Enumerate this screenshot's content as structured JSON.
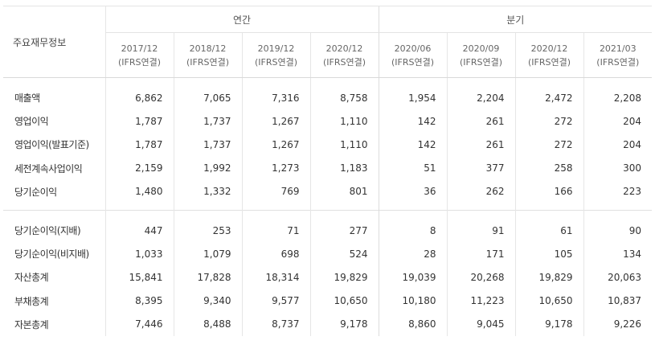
{
  "header": {
    "row_label": "주요재무정보",
    "annual_label": "연간",
    "quarterly_label": "분기",
    "periods": [
      {
        "date": "2017/12",
        "basis": "(IFRS연결)"
      },
      {
        "date": "2018/12",
        "basis": "(IFRS연결)"
      },
      {
        "date": "2019/12",
        "basis": "(IFRS연결)"
      },
      {
        "date": "2020/12",
        "basis": "(IFRS연결)"
      },
      {
        "date": "2020/06",
        "basis": "(IFRS연결)"
      },
      {
        "date": "2020/09",
        "basis": "(IFRS연결)"
      },
      {
        "date": "2020/12",
        "basis": "(IFRS연결)"
      },
      {
        "date": "2021/03",
        "basis": "(IFRS연결)"
      }
    ]
  },
  "rows": [
    {
      "label": "매출액",
      "values": [
        "6,862",
        "7,065",
        "7,316",
        "8,758",
        "1,954",
        "2,204",
        "2,472",
        "2,208"
      ]
    },
    {
      "label": "영업이익",
      "values": [
        "1,787",
        "1,737",
        "1,267",
        "1,110",
        "142",
        "261",
        "272",
        "204"
      ]
    },
    {
      "label": "영업이익(발표기준)",
      "values": [
        "1,787",
        "1,737",
        "1,267",
        "1,110",
        "142",
        "261",
        "272",
        "204"
      ]
    },
    {
      "label": "세전계속사업이익",
      "values": [
        "2,159",
        "1,992",
        "1,273",
        "1,183",
        "51",
        "377",
        "258",
        "300"
      ]
    },
    {
      "label": "당기순이익",
      "values": [
        "1,480",
        "1,332",
        "769",
        "801",
        "36",
        "262",
        "166",
        "223"
      ]
    },
    {
      "label": "당기순이익(지배)",
      "values": [
        "447",
        "253",
        "71",
        "277",
        "8",
        "91",
        "61",
        "90"
      ]
    },
    {
      "label": "당기순이익(비지배)",
      "values": [
        "1,033",
        "1,079",
        "698",
        "524",
        "28",
        "171",
        "105",
        "134"
      ]
    },
    {
      "label": "자산총계",
      "values": [
        "15,841",
        "17,828",
        "18,314",
        "19,829",
        "19,039",
        "20,268",
        "19,829",
        "20,063"
      ]
    },
    {
      "label": "부채총계",
      "values": [
        "8,395",
        "9,340",
        "9,577",
        "10,650",
        "10,180",
        "11,223",
        "10,650",
        "10,837"
      ]
    },
    {
      "label": "자본총계",
      "values": [
        "7,446",
        "8,488",
        "8,737",
        "9,178",
        "8,860",
        "9,045",
        "9,178",
        "9,226"
      ]
    }
  ]
}
